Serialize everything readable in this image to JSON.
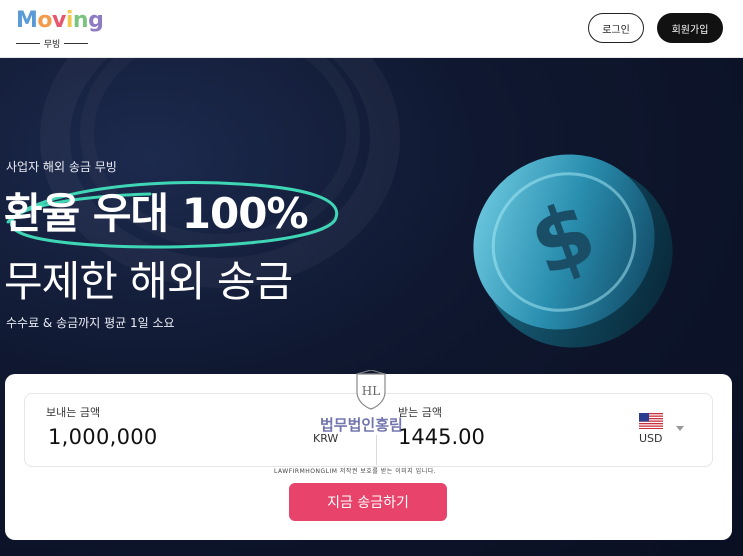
{
  "header": {
    "logo_letters": [
      "M",
      "o",
      "v",
      "i",
      "n",
      "g"
    ],
    "logo_colors": [
      "#5b9bd5",
      "#f29b4b",
      "#e8566e",
      "#f2c94c",
      "#7bc47f",
      "#8e7cc3"
    ],
    "logo_sub": "무빙",
    "login_label": "로그인",
    "signup_label": "회원가입"
  },
  "hero": {
    "eyebrow": "사업자 해외 송금 무빙",
    "title_line1": "환율 우대 100%",
    "title_line2": "무제한 해외 송금",
    "subline": "수수료 & 송금까지 평균 1일 소요",
    "scribble_color": "#3fd6b5",
    "coin_icon": "dollar-coin-icon"
  },
  "transfer": {
    "send_label": "보내는 금액",
    "send_amount": "1,000,000",
    "send_currency": "KRW",
    "receive_label": "받는 금액",
    "receive_amount": "1445.00",
    "receive_currency": "USD",
    "flag_icon": "us-flag-icon",
    "submit_label": "지금 송금하기",
    "submit_color": "#e8436b"
  },
  "watermark": {
    "emblem_letters": "HL",
    "name": "법무법인홍림",
    "caption": "LAWFIRMHONGLIM 저작권 보호를 받는 이미지 입니다."
  }
}
